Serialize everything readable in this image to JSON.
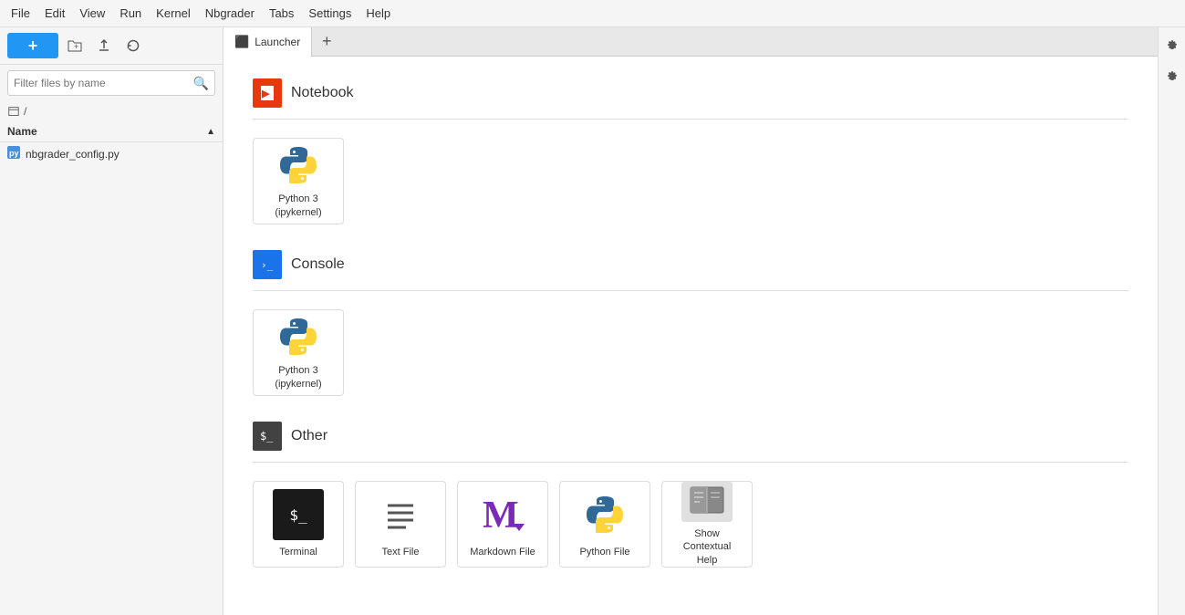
{
  "menubar": {
    "items": [
      "File",
      "Edit",
      "View",
      "Run",
      "Kernel",
      "Nbgrader",
      "Tabs",
      "Settings",
      "Help"
    ]
  },
  "sidebar": {
    "new_button": "+",
    "filter_placeholder": "Filter files by name",
    "breadcrumb": "/",
    "name_column": "Name",
    "files": [
      {
        "name": "nbgrader_config.py",
        "icon": "python-file-icon"
      }
    ]
  },
  "tabs": [
    {
      "label": "Launcher",
      "icon": "launcher-icon",
      "active": true
    }
  ],
  "tab_add": "+",
  "launcher": {
    "sections": [
      {
        "id": "notebook",
        "label": "Notebook",
        "cards": [
          {
            "id": "python3-notebook",
            "label": "Python 3\n(ipykernel)"
          }
        ]
      },
      {
        "id": "console",
        "label": "Console",
        "cards": [
          {
            "id": "python3-console",
            "label": "Python 3\n(ipykernel)"
          }
        ]
      },
      {
        "id": "other",
        "label": "Other",
        "cards": [
          {
            "id": "terminal",
            "label": "Terminal"
          },
          {
            "id": "text-file",
            "label": "Text File"
          },
          {
            "id": "markdown-file",
            "label": "Markdown File"
          },
          {
            "id": "python-file",
            "label": "Python File"
          },
          {
            "id": "contextual-help",
            "label": "Show Contextual\nHelp"
          }
        ]
      }
    ]
  },
  "colors": {
    "accent_blue": "#2196f3",
    "notebook_red": "#e8380e",
    "console_blue": "#1a73e8",
    "other_dark": "#424242"
  }
}
